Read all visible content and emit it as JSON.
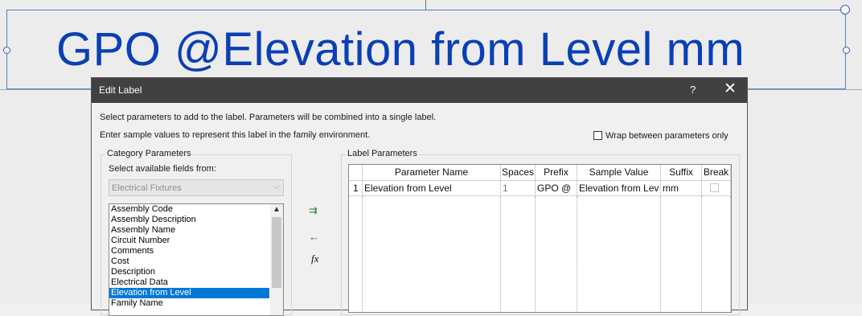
{
  "canvas": {
    "label_text": "GPO @Elevation from Level mm"
  },
  "dialog": {
    "title": "Edit Label",
    "help_icon": "?",
    "close_icon": "✕",
    "instruction1": "Select parameters to add to the label.  Parameters will be combined into a single label.",
    "instruction2": "Enter sample values to represent this label in the family environment.",
    "wrap_label": "Wrap between parameters only",
    "category_group": "Category Parameters",
    "select_fields_label": "Select available fields from:",
    "category_value": "Electrical Fixtures",
    "fields": [
      "Assembly Code",
      "Assembly Description",
      "Assembly Name",
      "Circuit Number",
      "Comments",
      "Cost",
      "Description",
      "Electrical Data",
      "Elevation from Level",
      "Family Name"
    ],
    "selected_field": "Elevation from Level",
    "label_group": "Label Parameters",
    "columns": [
      "",
      "Parameter Name",
      "Spaces",
      "Prefix",
      "Sample Value",
      "Suffix",
      "Break"
    ],
    "rows": [
      {
        "num": "1",
        "name": "Elevation from Level",
        "spaces": "1",
        "prefix": "GPO @",
        "sample": "Elevation from Lev",
        "suffix": "mm",
        "break": false
      }
    ],
    "fx_label": "fx"
  }
}
